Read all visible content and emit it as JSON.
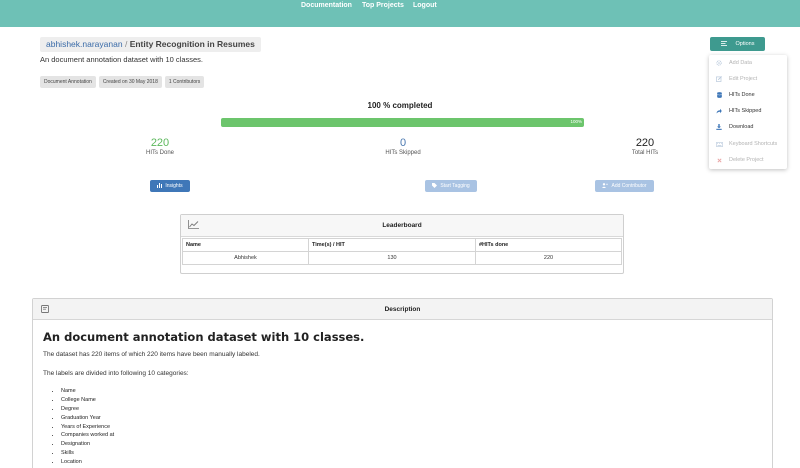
{
  "nav": {
    "documentation": "Documentation",
    "top_projects": "Top Projects",
    "logout": "Logout"
  },
  "breadcrumb": {
    "user": "abhishek.narayanan",
    "separator": "/",
    "project": "Entity Recognition in Resumes"
  },
  "subtitle": "An document annotation dataset with 10 classes.",
  "tags": [
    "Document Annotation",
    "Created on 30 May 2018",
    "1 Contributors"
  ],
  "progress": {
    "label": "100 % completed",
    "percent": 100,
    "bar_text": "100%"
  },
  "stats": {
    "done": {
      "value": "220",
      "label": "HITs Done"
    },
    "skipped": {
      "value": "0",
      "label": "HITs Skipped"
    },
    "total": {
      "value": "220",
      "label": "Total HITs"
    }
  },
  "buttons": {
    "insights": "Insights",
    "start_tagging": "Start Tagging",
    "add_contributor": "Add Contributor",
    "options": "Options"
  },
  "options_menu": {
    "items": [
      {
        "label": "Add Data",
        "icon": "gear-icon",
        "enabled": false
      },
      {
        "label": "Edit Project",
        "icon": "edit-icon",
        "enabled": false
      },
      {
        "label": "HITs Done",
        "icon": "database-icon",
        "enabled": true
      },
      {
        "label": "HITs Skipped",
        "icon": "share-icon",
        "enabled": true
      },
      {
        "label": "Download",
        "icon": "download-icon",
        "enabled": true
      },
      {
        "label": "Keyboard Shortcuts",
        "icon": "keyboard-icon",
        "enabled": false
      },
      {
        "label": "Delete Project",
        "icon": "close-icon",
        "enabled": false
      }
    ]
  },
  "leaderboard": {
    "title": "Leaderboard",
    "columns": [
      "Name",
      "Time(s) / HIT",
      "#HITs done"
    ],
    "rows": [
      {
        "name": "Abhishek",
        "time": "130",
        "hits": "220"
      }
    ]
  },
  "description": {
    "title": "Description",
    "heading": "An document annotation dataset with 10 classes.",
    "p1": "The dataset has 220 items of which 220 items have been manually labeled.",
    "p2": "The labels are divided into following 10 categories:",
    "categories": [
      "Name",
      "College Name",
      "Degree",
      "Graduation Year",
      "Years of Experience",
      "Companies worked at",
      "Designation",
      "Skills",
      "Location"
    ]
  },
  "colors": {
    "navbar": "#6ec1b6",
    "progress": "#6cc56c",
    "primary_button": "#3f77b8",
    "options_button": "#3e9a8f",
    "stat_done": "#5cb85c",
    "stat_skipped": "#4a78b0"
  }
}
